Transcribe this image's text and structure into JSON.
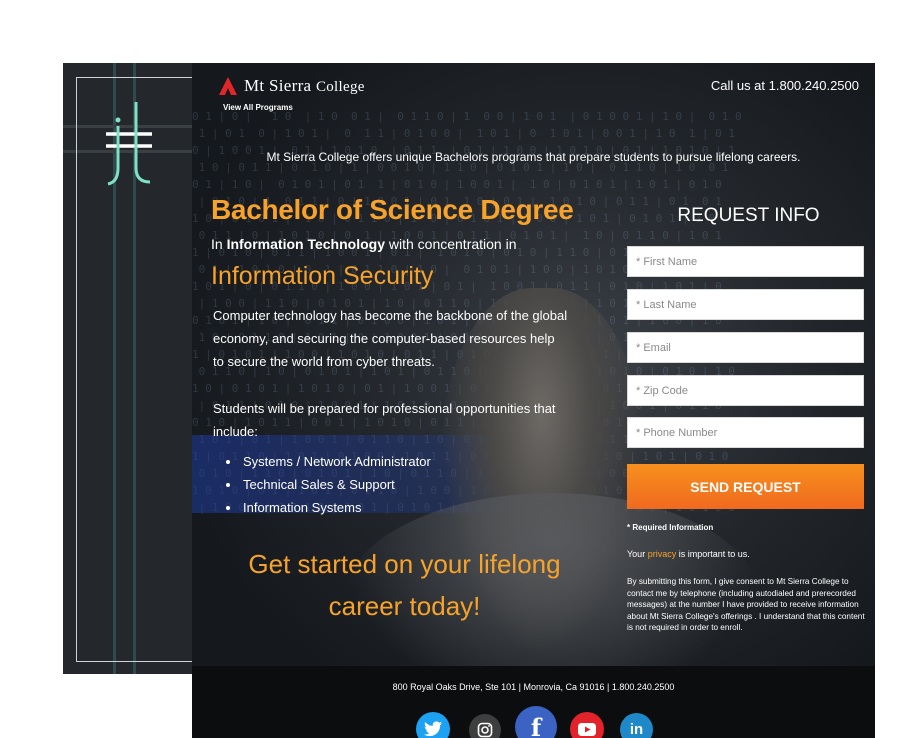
{
  "brand": {
    "college_name_main": "Mt Sierra",
    "college_name_suffix": "College",
    "view_programs": "View All Programs",
    "call_us": "Call us at 1.800.240.2500"
  },
  "hero": {
    "tagline": "Mt Sierra College offers unique Bachelors programs that prepare students to pursue lifelong careers.",
    "headline": "Bachelor of Science Degree",
    "subhead_prefix": "In ",
    "subhead_bold": "Information Technology",
    "subhead_suffix": " with concentration in",
    "concentration": "Information Security",
    "body_1": "Computer technology has become the backbone of the global economy, and securing the computer-based resources help to secure the world from cyber threats.",
    "body_2": "Students will be prepared for professional opportunities that include:",
    "careers": [
      "Systems / Network Administrator",
      "Technical Sales & Support",
      "Information Systems"
    ],
    "cta": "Get started on your lifelong career today!"
  },
  "form": {
    "title": "REQUEST INFO",
    "first_name_placeholder": "* First Name",
    "last_name_placeholder": "* Last Name",
    "email_placeholder": "* Email",
    "zip_placeholder": "* Zip Code",
    "phone_placeholder": "* Phone Number",
    "submit_label": "SEND REQUEST",
    "required_note": "* Required Information",
    "privacy_prefix": "Your ",
    "privacy_link": "privacy",
    "privacy_suffix": " is important to us.",
    "consent": "By submitting this form, I give consent to Mt Sierra College to contact me by telephone (including autodialed and prerecorded messages) at the number I have provided to receive information about Mt Sierra College's offerings . I understand that this content is not required in order to enroll."
  },
  "footer": {
    "address": "800 Royal Oaks Drive, Ste 101  |  Monrovia, Ca 91016  |  1.800.240.2500"
  },
  "colors": {
    "accent_orange": "#f7a32a",
    "button_orange": "#f06a1f",
    "background_dark": "#15181c"
  }
}
